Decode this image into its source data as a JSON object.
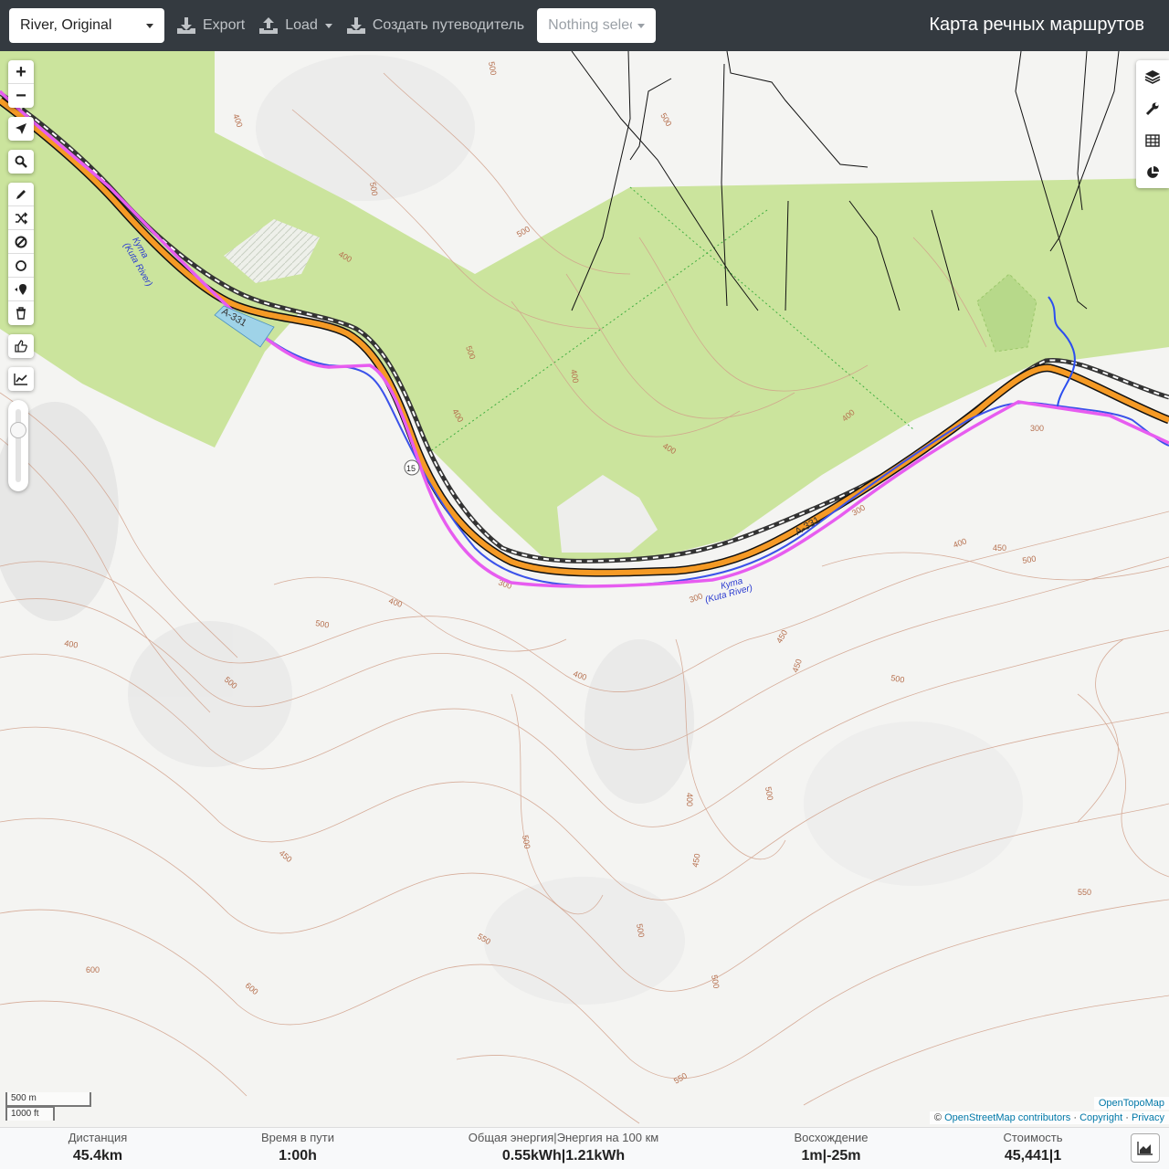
{
  "navbar": {
    "profile": "River, Original",
    "export_label": "Export",
    "load_label": "Load",
    "guide_label": "Создать путеводитель",
    "selection_placeholder": "Nothing selected",
    "brand": "Карта речных маршрутов"
  },
  "map": {
    "road_label_1": "A-331",
    "road_label_2": "A-331",
    "road_shield": "15",
    "river_name_1": "Кута",
    "river_name_1_en": "(Kuta River)",
    "river_name_2": "Кута",
    "river_name_2_en": "(Kuta River)",
    "contour_labels": [
      "400",
      "500",
      "500",
      "500",
      "500",
      "400",
      "500",
      "400",
      "400",
      "400",
      "300",
      "400",
      "300",
      "500",
      "450",
      "400",
      "300",
      "450",
      "400",
      "500",
      "500",
      "450",
      "400",
      "500",
      "400",
      "500",
      "400",
      "450",
      "500",
      "550",
      "450",
      "600",
      "600",
      "550",
      "500",
      "500",
      "550",
      "300"
    ],
    "colors": {
      "forest": "#c8e29a",
      "route": "#e75cf0",
      "road": "#f59a25",
      "river": "#2b4ef0",
      "contour": "#c78a70"
    }
  },
  "toolbar": {
    "zoom_in": "+",
    "zoom_out": "−",
    "icons": [
      "locate-icon",
      "search-icon",
      "draw-icon",
      "shuffle-icon",
      "no-go-area-icon",
      "circle-icon",
      "delete-point-icon",
      "trash-icon",
      "thumb-icon",
      "elevation-chart-icon"
    ]
  },
  "rightbar": {
    "icons": [
      "layers-icon",
      "settings-icon",
      "table-icon",
      "pie-chart-icon"
    ]
  },
  "scale": {
    "metric": "500 m",
    "imperial": "1000 ft"
  },
  "attribution": {
    "layer": "OpenTopoMap",
    "prefix": "©",
    "osm": "OpenStreetMap contributors",
    "sep1": "·",
    "copyright": "Copyright",
    "sep2": "·",
    "privacy": "Privacy"
  },
  "stats": {
    "distance": {
      "label": "Дистанция",
      "value": "45.4",
      "unit": "km"
    },
    "time": {
      "label": "Время в пути",
      "value": "1:00",
      "unit": "h"
    },
    "energy": {
      "label": "Общая энергия|Энергия на 100 км",
      "v1": "0.55",
      "u1": "kWh",
      "sep": "|",
      "v2": "1.21",
      "u2": "kWh"
    },
    "ascent": {
      "label": "Восхождение",
      "v1": "1",
      "u1": "m",
      "sep": "|",
      "v2": "-25",
      "u2": "m"
    },
    "cost": {
      "label": "Стоимость",
      "v1": "45,441",
      "sep": "|",
      "v2": "1"
    }
  }
}
